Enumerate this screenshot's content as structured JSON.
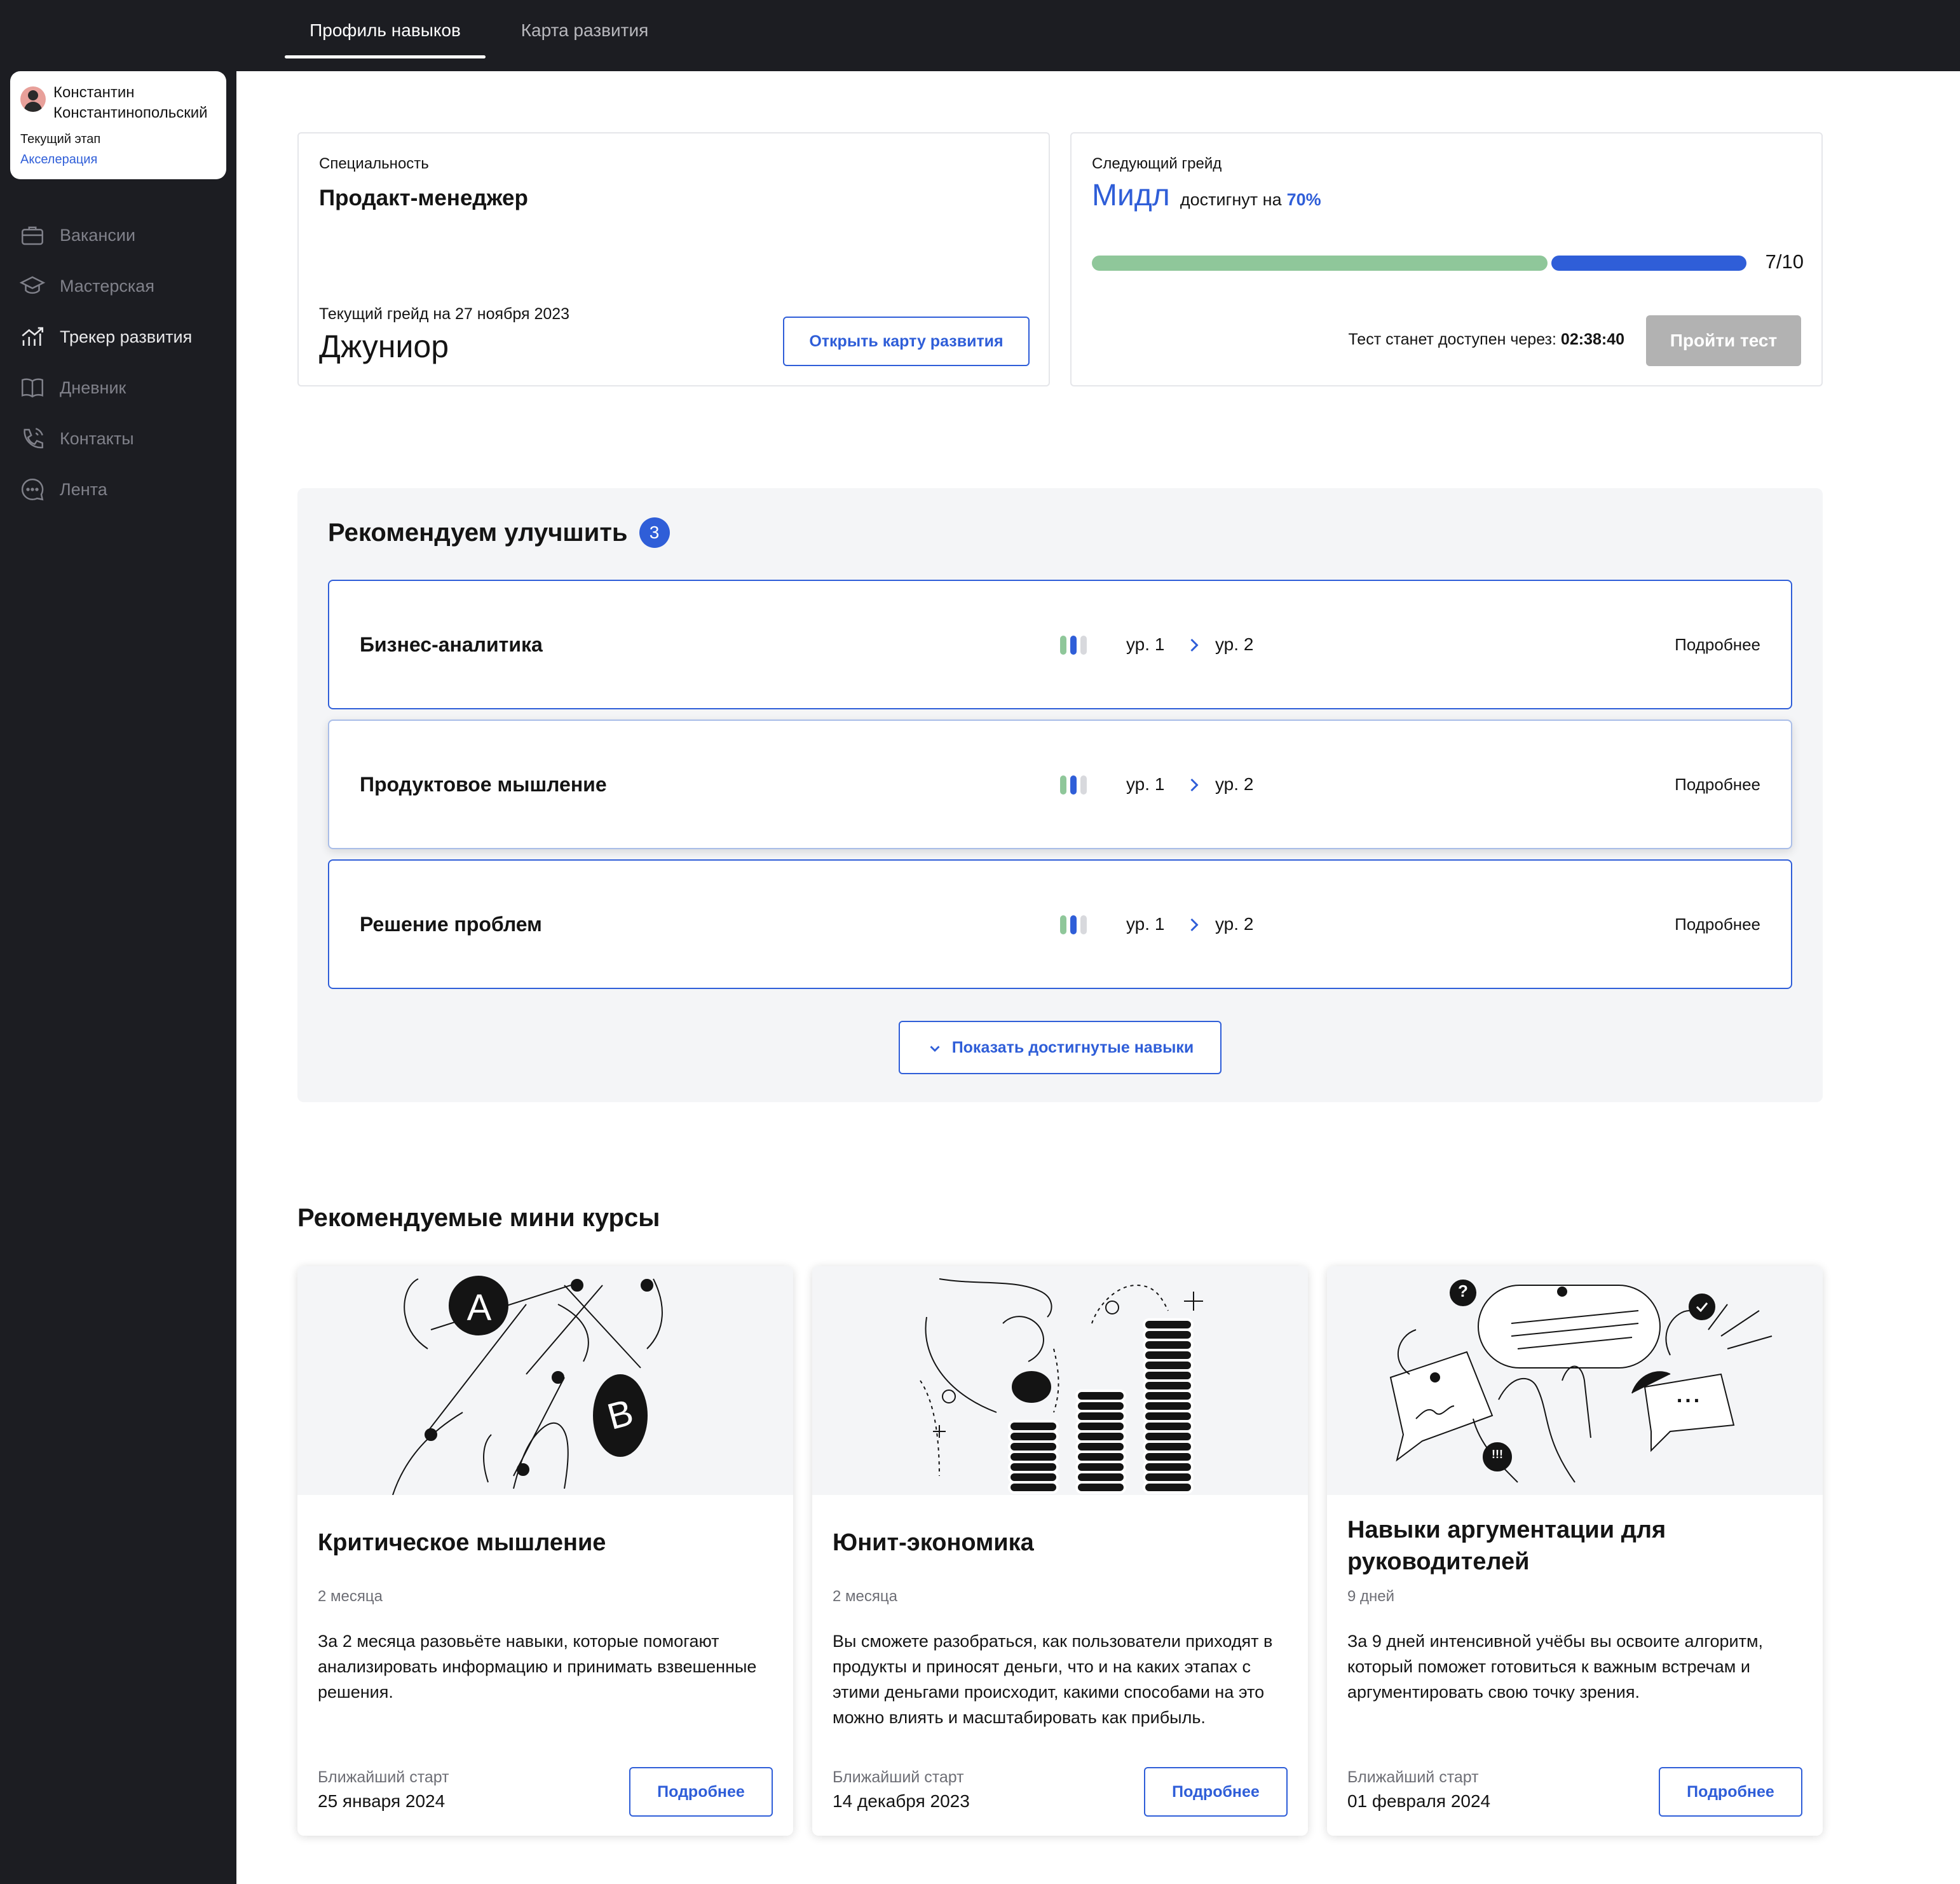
{
  "tabs": [
    {
      "label": "Профиль навыков"
    },
    {
      "label": "Карта развития"
    }
  ],
  "user": {
    "first_name": "Константин",
    "last_name": "Константинопольский",
    "stage_label": "Текущий этап",
    "stage_value": "Акселерация"
  },
  "nav": [
    {
      "label": "Вакансии",
      "icon": "briefcase-icon"
    },
    {
      "label": "Мастерская",
      "icon": "graduation-cap-icon"
    },
    {
      "label": "Трекер развития",
      "icon": "chart-icon"
    },
    {
      "label": "Дневник",
      "icon": "book-icon"
    },
    {
      "label": "Контакты",
      "icon": "phone-icon"
    },
    {
      "label": "Лента",
      "icon": "chat-icon"
    }
  ],
  "specialty": {
    "label": "Специальность",
    "value": "Продакт-менеджер",
    "grade_label": "Текущий грейд на 27 ноября 2023",
    "grade_value": "Джуниор",
    "button": "Открыть карту развития"
  },
  "next_grade": {
    "label": "Следующий грейд",
    "value": "Мидл",
    "reached_text": "достигнут на",
    "percent": "70%",
    "progress_text": "7/10",
    "progress_done": 7,
    "progress_total": 10,
    "timer_label": "Тест станет доступен через:",
    "timer_value": "02:38:40",
    "button": "Пройти тест"
  },
  "recommend": {
    "title": "Рекомендуем улучшить",
    "count": "3",
    "skills": [
      {
        "name": "Бизнес-аналитика",
        "from": "ур. 1",
        "to": "ур. 2",
        "link": "Подробнее"
      },
      {
        "name": "Продуктовое мышление",
        "from": "ур. 1",
        "to": "ур. 2",
        "link": "Подробнее"
      },
      {
        "name": "Решение проблем",
        "from": "ур. 1",
        "to": "ур. 2",
        "link": "Подробнее"
      }
    ],
    "show_button": "Показать достигнутые навыки"
  },
  "courses": {
    "title": "Рекомендуемые мини курсы",
    "items": [
      {
        "title": "Критическое мышление",
        "duration": "2 месяца",
        "description": "За 2 месяца разовьёте навыки, которые помогают анализировать информацию и принимать взвешенные решения.",
        "start_label": "Ближайший старт",
        "start_date": "25 января 2024",
        "button": "Подробнее",
        "illus_letters": [
          "A",
          "B"
        ]
      },
      {
        "title": "Юнит-экономика",
        "duration": "2 месяца",
        "description": "Вы сможете разобраться, как пользователи приходят в продукты и приносят деньги, что и на каких этапах с этими деньгами происходит, какими способами на это можно влиять и масштабировать как прибыль.",
        "start_label": "Ближайший старт",
        "start_date": "14 декабря 2023",
        "button": "Подробнее"
      },
      {
        "title": "Навыки аргументации для руководителей",
        "duration": "9 дней",
        "description": "За 9 дней интенсивной учёбы вы освоите алгоритм, который поможет готовиться к важным встречам и аргументировать свою точку зрения.",
        "start_label": "Ближайший старт",
        "start_date": "01 февраля 2024",
        "button": "Подробнее",
        "illus_symbols": [
          "?",
          "!!!",
          "..."
        ]
      }
    ]
  },
  "colors": {
    "accent": "#2f5ed8",
    "progress_done": "#8fc79a",
    "dark_bg": "#1c1d22",
    "disabled_button": "#b2b2b2"
  }
}
